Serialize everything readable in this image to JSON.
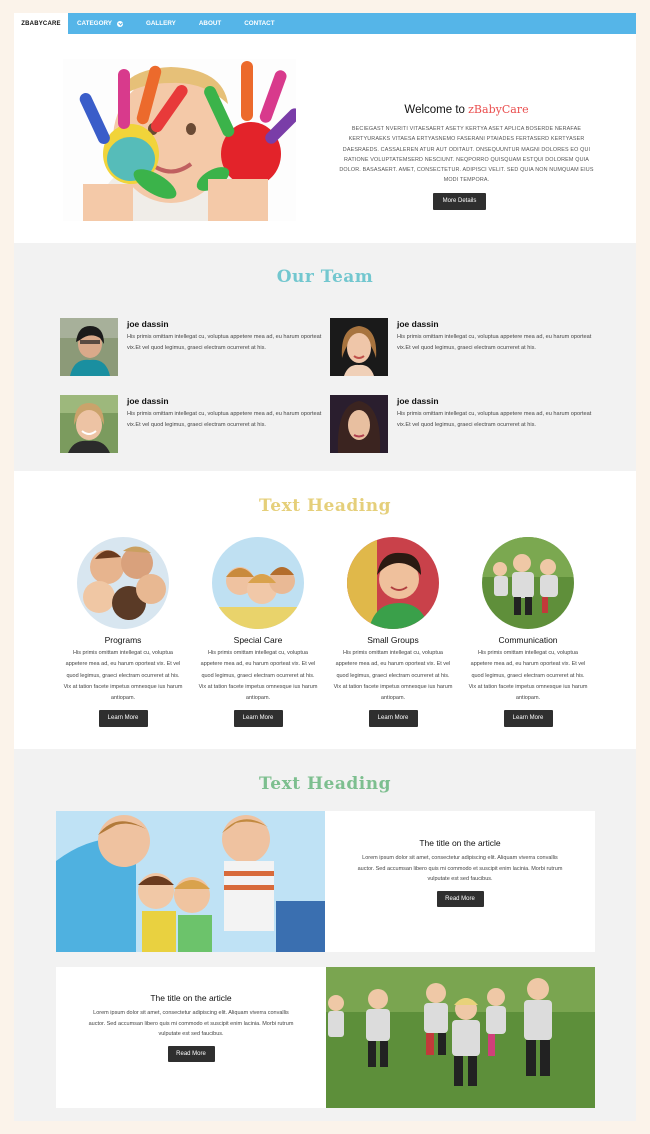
{
  "nav": {
    "brand": "ZBABYCARE",
    "items": [
      {
        "label": "CATEGORY",
        "has_dropdown": true
      },
      {
        "label": "GALLERY"
      },
      {
        "label": "ABOUT"
      },
      {
        "label": "CONTACT"
      }
    ]
  },
  "hero": {
    "title_prefix": "Welcome to",
    "title_brand": "zBabyCare",
    "text": "Beciegast nveriti vitaesaert asety kertya aset aplica boserde nerafae kertyuraeks vitaesa ertyasnemo faserani ptaiades fertaserd kertyaser daesraeds. Cassaleren atur aut oditaut. Onsequuntur magni dolores eo qui ratione voluptatemserd nesciunt. Neqporro quisquam estqui dolorem quia dolor. basasaert. amet, consectetur. adipisci velit. sed quia non numquam eius modi tempora.",
    "button": "More Details"
  },
  "team": {
    "title": "Our Team",
    "members": [
      {
        "name": "joe dassin",
        "bio": "His primis omittam intellegat cu, voluptua appetere mea ad, eu harum oporteat vix.Et vel quod legimus, graeci electram ocurreret at his."
      },
      {
        "name": "joe dassin",
        "bio": "His primis omittam intellegat cu, voluptua appetere mea ad, eu harum oporteat vix.Et vel quod legimus, graeci electram ocurreret at his."
      },
      {
        "name": "joe dassin",
        "bio": "His primis omittam intellegat cu, voluptua appetere mea ad, eu harum oporteat vix.Et vel quod legimus, graeci electram ocurreret at his."
      },
      {
        "name": "joe dassin",
        "bio": "His primis omittam intellegat cu, voluptua appetere mea ad, eu harum oporteat vix.Et vel quod legimus, graeci electram ocurreret at his."
      }
    ]
  },
  "features": {
    "title": "Text Heading",
    "items": [
      {
        "name": "Programs",
        "text": "His primis omittam intellegat cu, voluptua appetere mea ad, eu harum oporteat vix. Et vel quod legimus, graeci electram ocurreret at his. Vix at tation facete impetus omnesque ius harum antiopam.",
        "button": "Learn More"
      },
      {
        "name": "Special Care",
        "text": "His primis omittam intellegat cu, voluptua appetere mea ad, eu harum oporteat vix. Et vel quod legimus, graeci electram ocurreret at his. Vix at tation facete impetus omnesque ius harum antiopam.",
        "button": "Learn More"
      },
      {
        "name": "Small Groups",
        "text": "His primis omittam intellegat cu, voluptua appetere mea ad, eu harum oporteat vix. Et vel quod legimus, graeci electram ocurreret at his. Vix at tation facete impetus omnesque ius harum antiopam.",
        "button": "Learn More"
      },
      {
        "name": "Communication",
        "text": "His primis omittam intellegat cu, voluptua appetere mea ad, eu harum oporteat vix. Et vel quod legimus, graeci electram ocurreret at his. Vix at tation facete impetus omnesque ius harum antiopam.",
        "button": "Learn More"
      }
    ]
  },
  "articles": {
    "title": "Text Heading",
    "items": [
      {
        "title": "The title on the article",
        "text": "Lorem ipsum dolor sit amet, consectetur adipiscing elit. Aliquam viverra convallis auctor. Sed accumsan libero quis mi commodo et suscipit enim lacinia. Morbi rutrum vulputate est sed faucibus.",
        "button": "Read More"
      },
      {
        "title": "The title on the article",
        "text": "Lorem ipsum dolor sit amet, consectetur adipiscing elit. Aliquam viverra convallis auctor. Sed accumsan libero quis mi commodo et suscipit enim lacinia. Morbi rutrum vulputate est sed faucibus.",
        "button": "Read More"
      }
    ]
  },
  "colors": {
    "nav_bg": "#55b5e8",
    "brand_red": "#ea4f4f",
    "team_title": "#73c7cf",
    "features_title": "#e5cf7a",
    "articles_title": "#7dbf8f",
    "button_bg": "#2f2f2f"
  }
}
